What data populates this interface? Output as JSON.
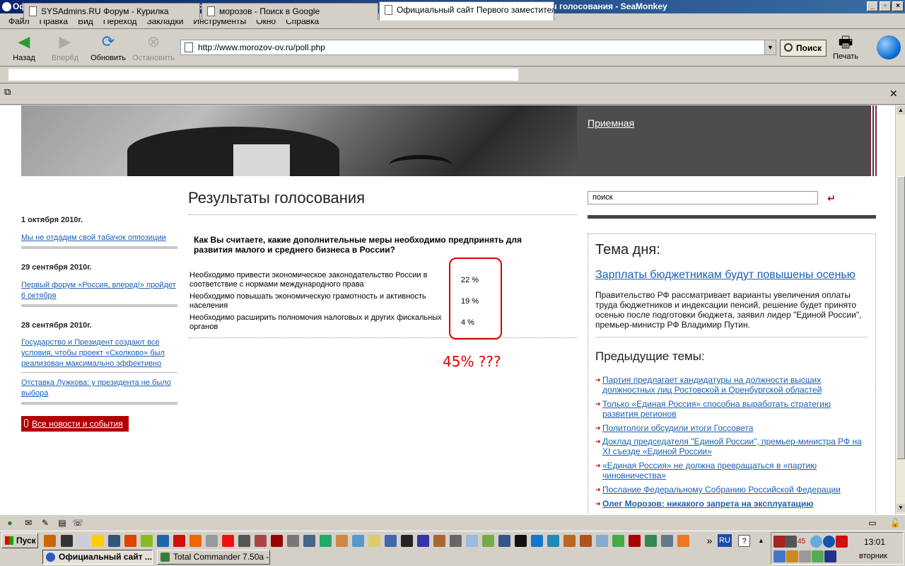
{
  "window": {
    "title": "Официальный сайт Первого заместителя Председателя Государственной Думы РФ Морозова Олега Викторовича :: Результаты голосования - SeaMonkey",
    "controls": [
      "_",
      "▫",
      "×"
    ]
  },
  "menu": [
    "Файл",
    "Правка",
    "Вид",
    "Переход",
    "Закладки",
    "Инструменты",
    "Окно",
    "Справка"
  ],
  "toolbar": {
    "back": "Назад",
    "forward": "Вперёд",
    "reload": "Обновить",
    "stop": "Остановить",
    "url": "http://www.morozov-ov.ru/poll.php",
    "search": "Поиск",
    "print": "Печать"
  },
  "tabs": [
    {
      "label": "SYSAdmins.RU Форум - Курилка"
    },
    {
      "label": "морозов - Поиск в Google"
    },
    {
      "label": "Официальный сайт Первого заместител..."
    }
  ],
  "page": {
    "header_link": "Приемная",
    "title": "Результаты голосования",
    "search_value": "поиск",
    "search_go": "↵",
    "news": [
      {
        "date": "1 октября 2010г.",
        "items": [
          "Мы не отдадим свой табачок оппозиции"
        ]
      },
      {
        "date": "29 сентября 2010г.",
        "items": [
          "Первый форум «Россия, вперед!» пройдет 6 октября"
        ]
      },
      {
        "date": "28 сентября 2010г.",
        "items": [
          "Государство и Президент создают все условия, чтобы проект «Сколково» был реализован максимально эффективно",
          "Отставка Лужкова: у президента не было выбора"
        ]
      }
    ],
    "all_news": "Все новости и события",
    "poll": {
      "question": "Как Вы считаете, какие дополнительные меры необходимо предпринять для развития малого и среднего бизнеса в России?",
      "answers": [
        {
          "text": "Необходимо привести экономическое законодательство России в соответствие с нормами международного права",
          "percent": "22 %"
        },
        {
          "text": "Необходимо повышать экономическую грамотность и активность населения",
          "percent": "19 %"
        },
        {
          "text": "Необходимо расширить полномочия налоговых и других фискальных органов",
          "percent": "4 %"
        }
      ],
      "annotation": "45% ???"
    },
    "topic": {
      "heading": "Тема дня:",
      "link": "Зарплаты бюджетникам будут повышены осенью",
      "text": "Правительство РФ рассматривает варианты увеличения оплаты труда бюджетников и индексации пенсий, решение будет принято осенью после подготовки бюджета, заявил лидер \"Единой России\", премьер-министр РФ Владимир Путин."
    },
    "previous": {
      "heading": "Предыдущие темы:",
      "items": [
        "Партия предлагает кандидатуры на должности высших должностных лиц Ростовской и Оренбургской областей",
        "Только «Единая Россия» способна выработать стратегию развития регионов",
        "Политологи обсудили итоги Госсовета",
        "Доклад председателя \"Единой России\", премьер-министра РФ на XI съезде «Единой России»",
        "«Единая Россия» не должна превращаться в «партию чиновничества»",
        "Послание Федеральному Собранию Российской Федерации",
        "Олег Морозов: никакого запрета на эксплуатацию"
      ]
    }
  },
  "taskbar": {
    "start": "Пуск",
    "tasks": [
      "Официальный сайт ...",
      "Total Commander 7.50a - ..."
    ],
    "lang": "RU",
    "tray_number": "45",
    "time": "13:01",
    "weekday": "вторник"
  },
  "colors": {
    "annotation_red": "#e00000",
    "link_blue": "#1a5fb4",
    "all_news_bg": "#b00000",
    "banner_dark": "#4d4d4d"
  }
}
